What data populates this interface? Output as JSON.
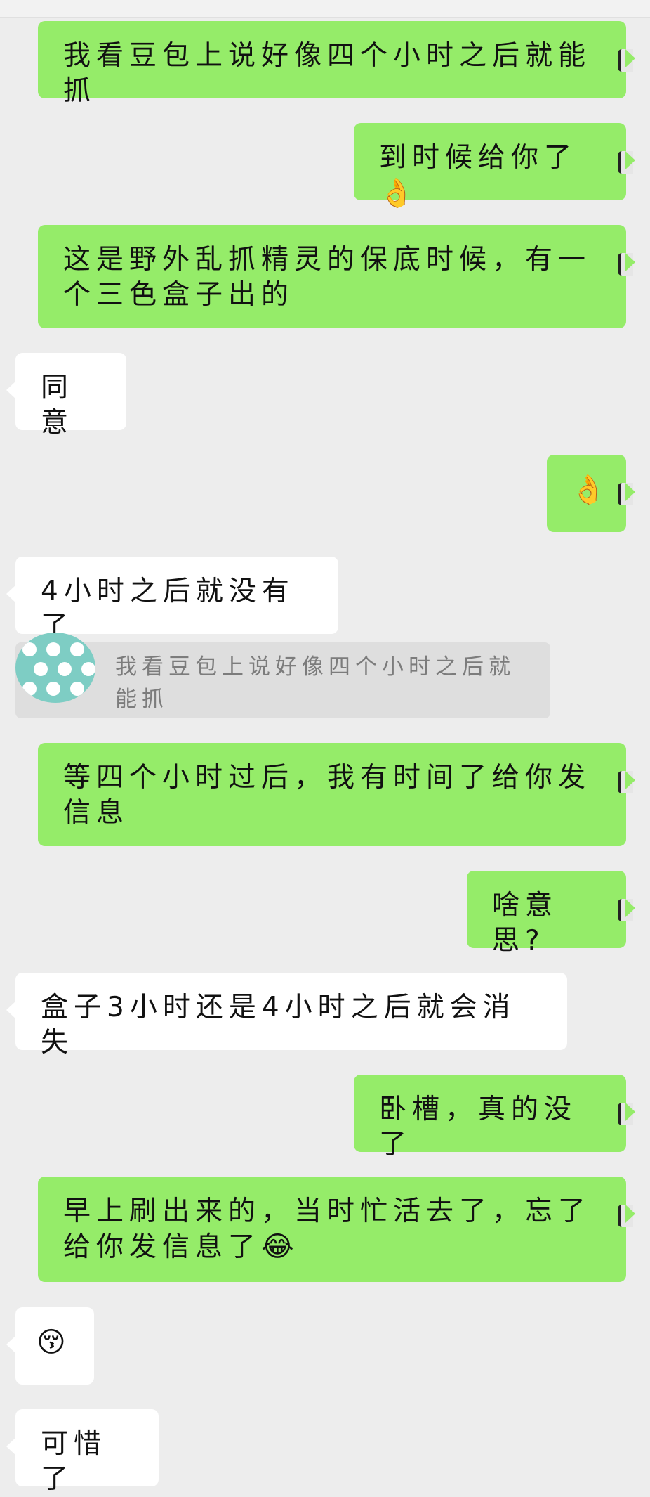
{
  "messages": [
    {
      "side": "me",
      "text": "我看豆包上说好像四个小时之后就能抓"
    },
    {
      "side": "me",
      "text": "到时候给你了",
      "emoji": "ok-hand"
    },
    {
      "side": "me",
      "text": "这是野外乱抓精灵的保底时候，有一个三色盒子出的"
    },
    {
      "side": "other",
      "text": "同意"
    },
    {
      "side": "me",
      "text": "",
      "emoji": "ok-hand"
    },
    {
      "side": "other",
      "text": "4小时之后就没有了"
    },
    {
      "side": "quote",
      "text": "我看豆包上说好像四个小时之后就能抓"
    },
    {
      "side": "me",
      "text": "等四个小时过后，我有时间了给你发信息"
    },
    {
      "side": "me",
      "text": "啥意思?"
    },
    {
      "side": "other",
      "text": "盒子3小时还是4小时之后就会消失"
    },
    {
      "side": "me",
      "text": "卧槽，真的没了"
    },
    {
      "side": "me",
      "text": "早上刷出来的，当时忙活去了，忘了给你发信息了",
      "emoji": "laughing-crying"
    },
    {
      "side": "other",
      "text": "",
      "emoji": "unamused-face"
    },
    {
      "side": "other",
      "text": "可惜了"
    }
  ],
  "colors": {
    "sent_bubble": "#95ec69",
    "received_bubble": "#ffffff",
    "background": "#ededed",
    "quote_bg": "#dedede"
  }
}
